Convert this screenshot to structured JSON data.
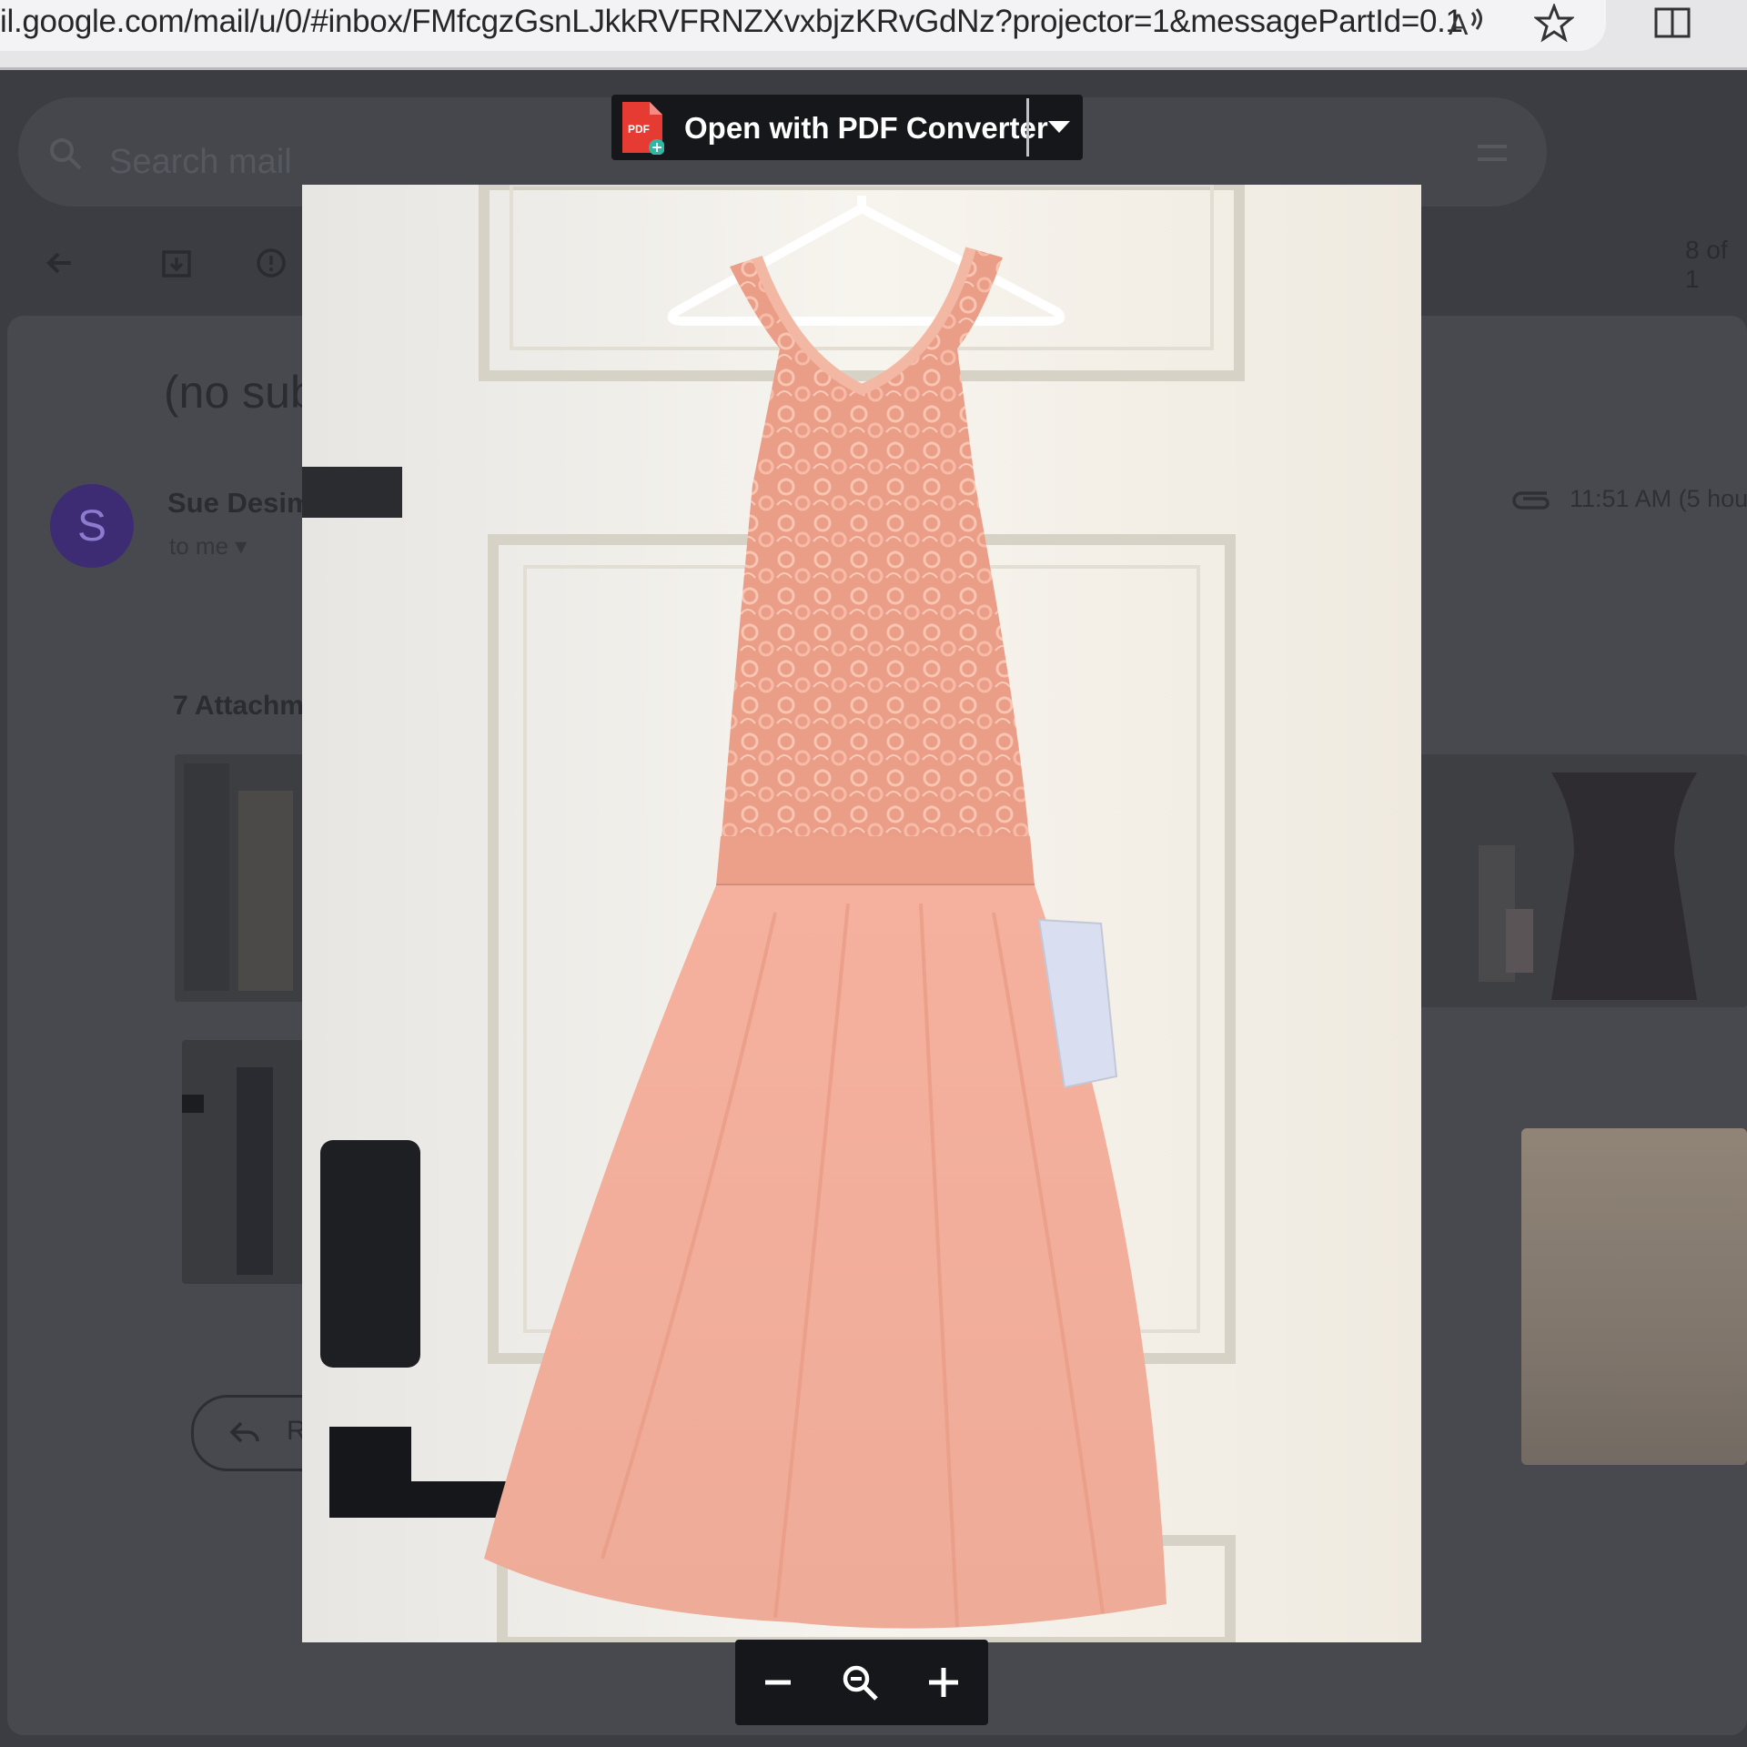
{
  "browser": {
    "url": "il.google.com/mail/u/0/#inbox/FMfcgzGsnLJkkRVFRNZXvxbjzKRvGdNz?projector=1&messagePartId=0.1"
  },
  "gmail": {
    "search_placeholder": "Search mail",
    "subject": "(no sub",
    "sender": "Sue Desim",
    "recipient": "to me",
    "timestamp": "11:51 AM (5 hou",
    "counter": "8 of 1",
    "attachments_label": "7 Attachm",
    "reply_label": "Rep",
    "avatar_letter": "S"
  },
  "viewer": {
    "open_with_label": "Open with PDF Converter",
    "pdf_badge": "PDF"
  },
  "colors": {
    "dress": "#f0a891",
    "door": "#f4f1ea",
    "viewer_bar": "#16171a",
    "avatar_bg": "#3d2c73"
  },
  "icons": [
    "read-aloud-icon",
    "star-icon",
    "split-screen-icon",
    "search-icon",
    "back-arrow-icon",
    "archive-icon",
    "report-spam-icon",
    "attachment-clip-icon",
    "reply-arrow-icon",
    "pdf-file-icon",
    "chevron-down-icon",
    "zoom-out-icon",
    "zoom-reset-icon",
    "zoom-in-icon",
    "filter-icon"
  ]
}
